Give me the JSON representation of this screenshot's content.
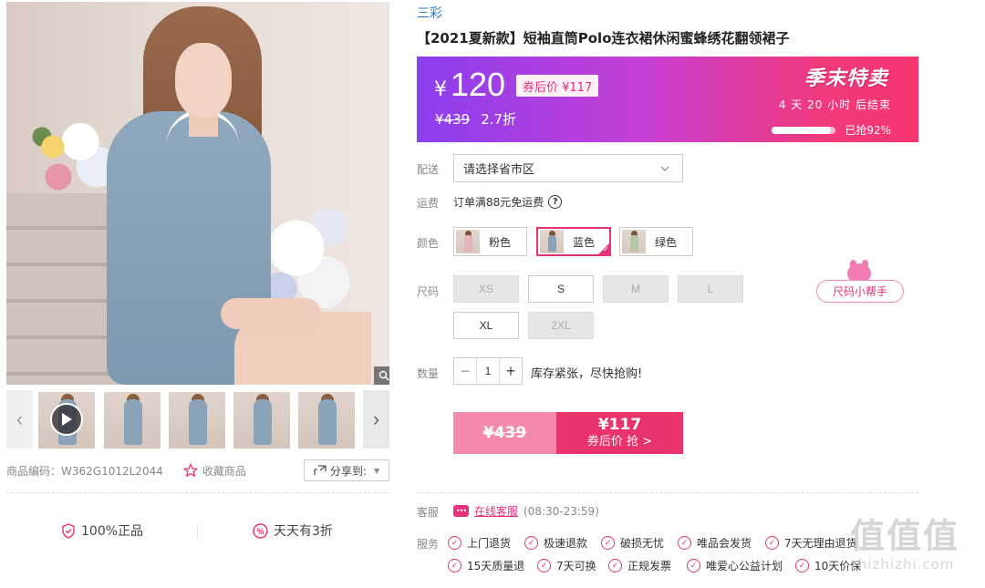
{
  "product": {
    "brand": "三彩",
    "title": "【2021夏新款】短袖直筒Polo连衣裙休闲蜜蜂绣花翻领裙子",
    "code_label": "商品编码：",
    "code": "W362G1012L2044",
    "favorite_label": "收藏商品",
    "share_label": "分享到:"
  },
  "gallery": {
    "thumbnails": [
      "video",
      "photo",
      "photo",
      "photo",
      "photo",
      "photo"
    ]
  },
  "promises": [
    {
      "icon": "shield-icon",
      "label": "100%正品"
    },
    {
      "icon": "percent-icon",
      "label": "天天有3折"
    }
  ],
  "price": {
    "currency": "¥",
    "current": "120",
    "coupon_tag": "券后价 ¥117",
    "original": "¥439",
    "discount": "2.7折",
    "event": "季末特卖",
    "countdown": "4 天 20 小时 后结束",
    "sold_label": "已抢92%",
    "sold_fraction": 0.92,
    "accent": "#e5327a"
  },
  "delivery": {
    "label": "配送",
    "placeholder": "请选择省市区"
  },
  "shipping": {
    "label": "运费",
    "text": "订单满88元免运费"
  },
  "colors": {
    "label": "颜色",
    "options": [
      {
        "name": "粉色",
        "swatch": "#e8b3b8"
      },
      {
        "name": "蓝色",
        "swatch": "#8aa3b9",
        "selected": true
      },
      {
        "name": "绿色",
        "swatch": "#b7c6a4"
      }
    ]
  },
  "sizes": {
    "label": "尺码",
    "options": [
      {
        "name": "XS",
        "available": false
      },
      {
        "name": "S",
        "available": true
      },
      {
        "name": "M",
        "available": false
      },
      {
        "name": "L",
        "available": false
      },
      {
        "name": "XL",
        "available": true
      },
      {
        "name": "2XL",
        "available": false
      }
    ],
    "helper": "尺码小帮手"
  },
  "quantity": {
    "label": "数量",
    "value": "1",
    "minus": "−",
    "plus": "+",
    "note": "库存紧张，尽快抢购!"
  },
  "buy": {
    "original": "¥439",
    "price": "¥117",
    "action": "券后价 抢 >"
  },
  "service": {
    "cs_label": "客服",
    "cs_link": "在线客服",
    "cs_hours": "(08:30-23:59)",
    "svc_label": "服务",
    "items": [
      "上门退货",
      "极速退款",
      "破损无忧",
      "唯品会发货",
      "7天无理由退货",
      "15天质量退",
      "7天可换",
      "正规发票",
      "唯爱心公益计划",
      "10天价保"
    ]
  },
  "watermark": {
    "big": "值值值",
    "small": "zhizhizhi.com"
  }
}
